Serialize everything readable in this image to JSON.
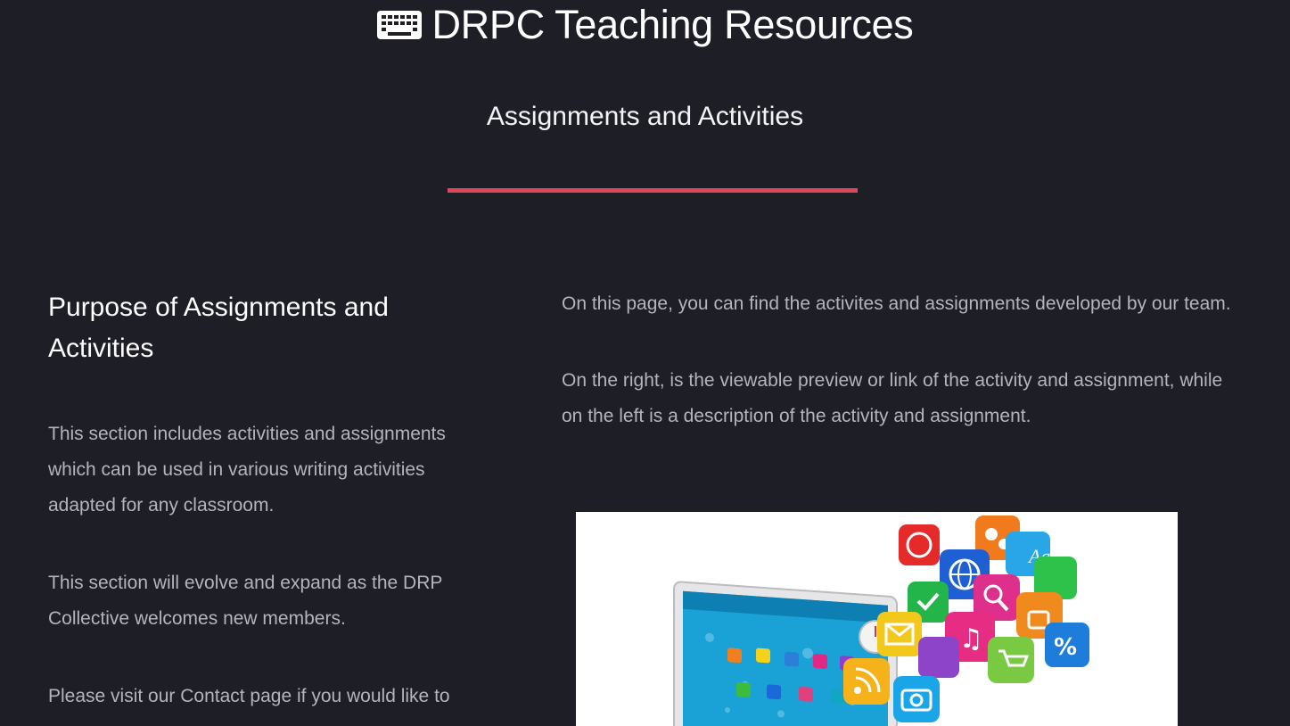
{
  "header": {
    "title": "DRPC Teaching Resources",
    "icon": "keyboard-icon",
    "subtitle": "Assignments and Activities",
    "accent_color": "#e1455d"
  },
  "left": {
    "heading": "Purpose of Assignments and Activities",
    "paragraphs": [
      "This section includes activities and assignments which can be used in various writing activities adapted for any classroom.",
      "This section will evolve and expand as the DRP Collective welcomes new members.",
      "Please visit our Contact page if you would like to"
    ]
  },
  "right": {
    "paragraphs": [
      "On this page, you can find the activites and assignments developed by our team.",
      "On the right, is the viewable preview or link of the activity and assignment, while on the left is a description of the activity and assignment."
    ],
    "image_alt": "laptop with colorful app icons"
  },
  "colors": {
    "background": "#1e1e26",
    "text": "#b4b4bc",
    "heading": "#ffffff"
  }
}
